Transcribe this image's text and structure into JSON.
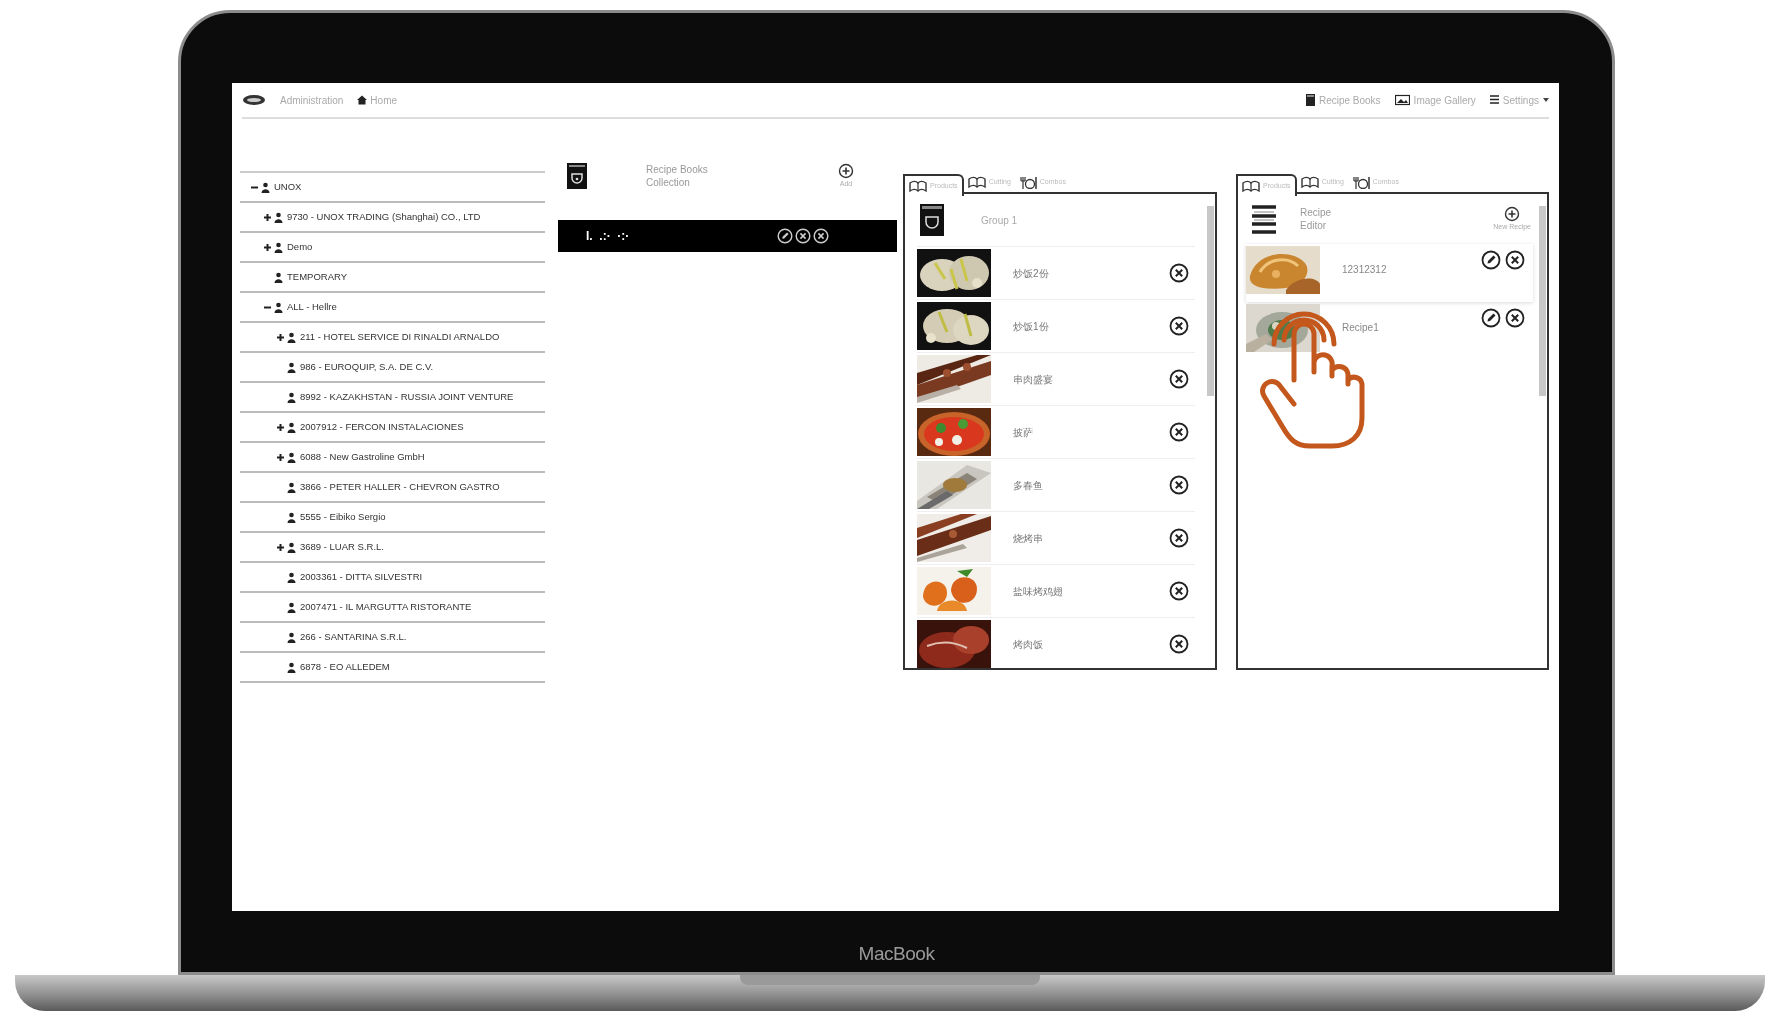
{
  "laptop": {
    "brand": "MacBook"
  },
  "header": {
    "breadcrumb": [
      {
        "label": "Administration"
      },
      {
        "label": "Home"
      }
    ],
    "nav": [
      {
        "label": "Recipe Books"
      },
      {
        "label": "Image Gallery"
      },
      {
        "label": "Settings",
        "dropdown": true
      }
    ]
  },
  "tree": [
    {
      "label": "UNOX",
      "kind": "folder",
      "expanded": true,
      "children": [
        {
          "label": "9730 - UNOX TRADING (Shanghai) CO., LTD",
          "kind": "folder",
          "expanded": false
        },
        {
          "label": "Demo",
          "kind": "folder",
          "expanded": false
        },
        {
          "label": "TEMPORARY",
          "kind": "leaf"
        },
        {
          "label": "ALL - Hellre",
          "kind": "folder",
          "expanded": true,
          "children": [
            {
              "label": "211 - HOTEL SERVICE DI RINALDI ARNALDO",
              "kind": "folder",
              "expanded": false
            },
            {
              "label": "986 - EUROQUIP, S.A. DE C.V.",
              "kind": "leaf"
            },
            {
              "label": "8992 - KAZAKHSTAN - RUSSIA JOINT VENTURE",
              "kind": "leaf"
            },
            {
              "label": "2007912 - FERCON INSTALACIONES",
              "kind": "folder",
              "expanded": false
            },
            {
              "label": "6088 - New Gastroline GmbH",
              "kind": "folder",
              "expanded": false
            },
            {
              "label": "3866 - PETER HALLER - CHEVRON GASTRO",
              "kind": "leaf"
            },
            {
              "label": "5555 - Eibiko Sergio",
              "kind": "leaf"
            },
            {
              "label": "3689 - LUAR S.R.L.",
              "kind": "folder",
              "expanded": false
            },
            {
              "label": "2003361 - DITTA SILVESTRI",
              "kind": "leaf"
            },
            {
              "label": "2007471 - IL MARGUTTA RISTORANTE",
              "kind": "leaf"
            },
            {
              "label": "266 - SANTARINA S.R.L.",
              "kind": "leaf"
            },
            {
              "label": "6878 - EO ALLEDEM",
              "kind": "leaf"
            }
          ]
        }
      ]
    }
  ],
  "collection": {
    "title": "Recipe Books Collection",
    "add_label": "Add",
    "items": [
      {
        "label": "I.  .:·  ·:·",
        "selected": true
      }
    ]
  },
  "group_panel": {
    "tabs": [
      {
        "label": "Products",
        "selected": true
      },
      {
        "label": "Cutting",
        "selected": false
      },
      {
        "label": "Combos",
        "selected": false
      }
    ],
    "title": "Group 1",
    "items": [
      {
        "name": "炒饭2份"
      },
      {
        "name": "炒饭1份"
      },
      {
        "name": "串肉盛宴"
      },
      {
        "name": "披萨"
      },
      {
        "name": "多春鱼"
      },
      {
        "name": "烧烤串"
      },
      {
        "name": "盐味烤鸡翅"
      },
      {
        "name": "烤肉饭"
      }
    ]
  },
  "recipe_panel": {
    "tabs": [
      {
        "label": "Products",
        "selected": true
      },
      {
        "label": "Cutting",
        "selected": false
      },
      {
        "label": "Combos",
        "selected": false
      }
    ],
    "title": "Recipe Editor",
    "add_label": "New Recipe",
    "items": [
      {
        "name": "12312312",
        "selected": true
      },
      {
        "name": "Recipe1",
        "selected": false
      }
    ]
  }
}
